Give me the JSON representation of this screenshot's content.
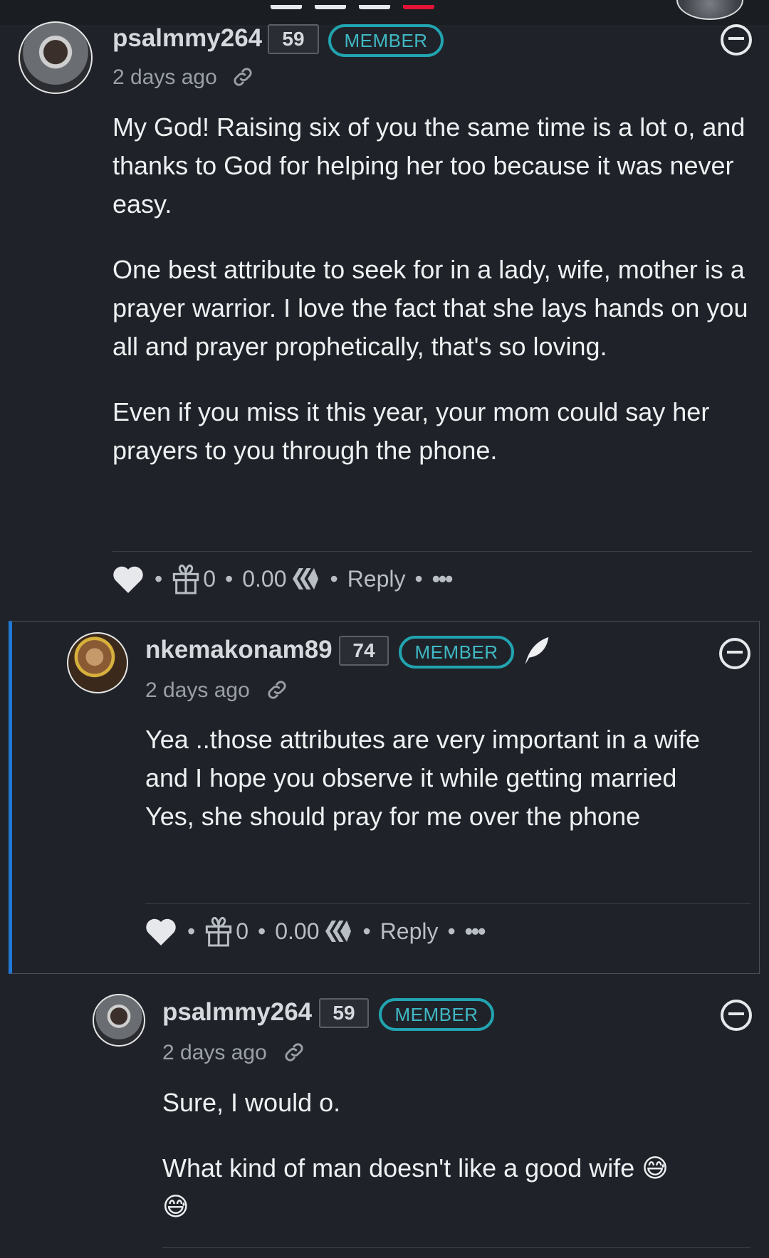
{
  "comments": [
    {
      "username": "psalmmy264",
      "reputation": "59",
      "badge": "MEMBER",
      "time": "2 days ago",
      "paragraphs": [
        "My God! Raising six of you the same time is a lot o, and thanks to God for helping her too because it was never easy.",
        "One best attribute to seek for in a lady, wife, mother is a prayer warrior. I love the fact that she lays hands on you all and prayer prophetically, that's so loving.",
        "Even if you miss it this year, your mom could say her prayers to you through the phone."
      ],
      "gift_count": "0",
      "payout": "0.00",
      "reply_label": "Reply",
      "more_label": "•••"
    },
    {
      "username": "nkemakonam89",
      "reputation": "74",
      "badge": "MEMBER",
      "time": "2 days ago",
      "paragraphs": [
        "Yea ..those attributes are very important in a wife and I hope you observe it while getting married",
        "Yes, she should pray for me over the phone"
      ],
      "gift_count": "0",
      "payout": "0.00",
      "reply_label": "Reply",
      "more_label": "•••"
    },
    {
      "username": "psalmmy264",
      "reputation": "59",
      "badge": "MEMBER",
      "time": "2 days ago",
      "paragraphs": [
        "Sure, I would o.",
        "What kind of man doesn't like a good wife 😅",
        "😅"
      ]
    }
  ],
  "icons": {
    "like": "heart-icon",
    "gift": "gift-icon",
    "currency": "hive-icon",
    "link": "link-icon",
    "collapse": "collapse-icon",
    "feather": "feather-icon"
  },
  "colors": {
    "background": "#1f2329",
    "accent_badge": "#21a4b0",
    "thread_line": "#1e78d6"
  }
}
